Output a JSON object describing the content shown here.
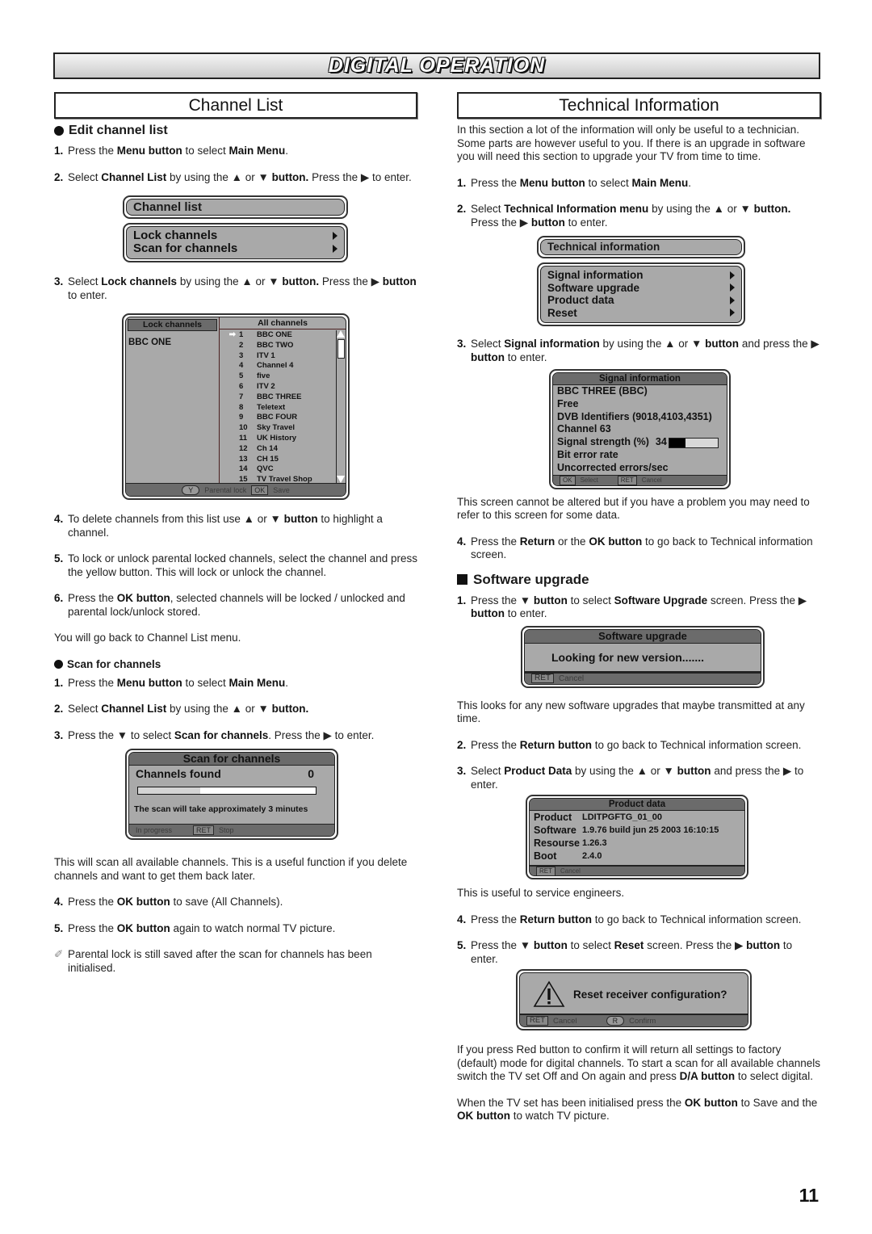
{
  "page": {
    "banner_title": "DIGITAL OPERATION",
    "page_number": "11"
  },
  "left": {
    "section_title": "Channel List",
    "edit": {
      "heading": "Edit channel list",
      "steps": [
        {
          "num": "1.",
          "parts": [
            [
              "Press the ",
              false
            ],
            [
              "Menu button",
              true
            ],
            [
              " to select ",
              false
            ],
            [
              "Main Menu",
              true
            ],
            [
              ".",
              false
            ]
          ]
        },
        {
          "num": "2.",
          "parts": [
            [
              "Select ",
              false
            ],
            [
              "Channel List",
              true
            ],
            [
              " by using the ▲ or ▼ ",
              false
            ],
            [
              "button.",
              true
            ],
            [
              "  Press the ▶ to enter.",
              false
            ]
          ]
        }
      ],
      "menu": {
        "title": "Channel list",
        "items": [
          {
            "label": "Lock channels",
            "icon": "arrow-right"
          },
          {
            "label": "Scan for channels",
            "icon": "arrow-right"
          }
        ]
      },
      "step3": {
        "num": "3.",
        "parts": [
          [
            "Select ",
            false
          ],
          [
            "Lock channels",
            true
          ],
          [
            " by using the ▲ or ▼ ",
            false
          ],
          [
            "button.",
            true
          ],
          [
            " Press the ▶ ",
            false
          ],
          [
            "button",
            true
          ],
          [
            " to enter.",
            false
          ]
        ]
      },
      "lock_screen": {
        "left_tab": "Lock channels",
        "current_channel": "BBC ONE",
        "right_tab": "All channels",
        "selected_index": 0,
        "channels": [
          {
            "num": "1",
            "name": "BBC ONE"
          },
          {
            "num": "2",
            "name": "BBC TWO"
          },
          {
            "num": "3",
            "name": "ITV 1"
          },
          {
            "num": "4",
            "name": "Channel 4"
          },
          {
            "num": "5",
            "name": "five"
          },
          {
            "num": "6",
            "name": "ITV 2"
          },
          {
            "num": "7",
            "name": "BBC THREE"
          },
          {
            "num": "8",
            "name": "Teletext"
          },
          {
            "num": "9",
            "name": "BBC FOUR"
          },
          {
            "num": "10",
            "name": "Sky Travel"
          },
          {
            "num": "11",
            "name": "UK History"
          },
          {
            "num": "12",
            "name": "Ch 14"
          },
          {
            "num": "13",
            "name": "CH 15"
          },
          {
            "num": "14",
            "name": "QVC"
          },
          {
            "num": "15",
            "name": "TV Travel Shop"
          }
        ],
        "footer": {
          "y_key": "Y",
          "y_label": "Parental lock",
          "ok_key": "OK",
          "ok_label": "Save"
        }
      },
      "steps_after": [
        {
          "num": "4.",
          "parts": [
            [
              "To delete channels from this list use ▲ or ▼ ",
              false
            ],
            [
              "button",
              true
            ],
            [
              " to highlight a channel.",
              false
            ]
          ]
        },
        {
          "num": "5.",
          "parts": [
            [
              "To lock or unlock parental locked channels, select the channel and press the yellow button. This will lock or unlock the channel.",
              false
            ]
          ]
        },
        {
          "num": "6.",
          "parts": [
            [
              "Press the ",
              false
            ],
            [
              "OK button",
              true
            ],
            [
              ", selected channels will be locked / unlocked and parental lock/unlock stored.",
              false
            ]
          ]
        }
      ],
      "back_text": "You will go back to Channel List menu."
    },
    "scan": {
      "heading": "Scan for channels",
      "steps": [
        {
          "num": "1.",
          "parts": [
            [
              "Press the ",
              false
            ],
            [
              "Menu button",
              true
            ],
            [
              " to select ",
              false
            ],
            [
              "Main Menu",
              true
            ],
            [
              ".",
              false
            ]
          ]
        },
        {
          "num": "2.",
          "parts": [
            [
              "Select ",
              false
            ],
            [
              "Channel List",
              true
            ],
            [
              " by using the ▲ or ▼ ",
              false
            ],
            [
              "button.",
              true
            ]
          ]
        },
        {
          "num": "3.",
          "parts": [
            [
              "Press the ▼ to select ",
              false
            ],
            [
              "Scan for channels",
              true
            ],
            [
              ". Press the ▶ to enter.",
              false
            ]
          ]
        }
      ],
      "screen": {
        "title": "Scan for channels",
        "found_label": "Channels found",
        "found_value": "0",
        "progress_fraction": 0.35,
        "message": "The scan will take approximately 3 minutes",
        "footer": {
          "status": "In progress",
          "ret_key": "RET",
          "ret_label": "Stop"
        }
      },
      "after_text": "This will scan all available channels. This is a useful function if you delete channels and want to get them back later.",
      "steps_after": [
        {
          "num": "4.",
          "parts": [
            [
              "Press the ",
              false
            ],
            [
              "OK button",
              true
            ],
            [
              " to save (All Channels).",
              false
            ]
          ]
        },
        {
          "num": "5.",
          "parts": [
            [
              "Press the ",
              false
            ],
            [
              "OK button",
              true
            ],
            [
              " again to watch normal TV picture.",
              false
            ]
          ]
        }
      ],
      "note": "Parental lock is still saved after the scan for channels has been initialised."
    }
  },
  "right": {
    "section_title": "Technical Information",
    "intro": "In this section a lot of the information will only be useful to a technician. Some parts are however useful to you. If there is an upgrade in software you will need this section to upgrade your TV from time to time.",
    "steps": [
      {
        "num": "1.",
        "parts": [
          [
            "Press the ",
            false
          ],
          [
            "Menu button",
            true
          ],
          [
            " to select ",
            false
          ],
          [
            "Main Menu",
            true
          ],
          [
            ".",
            false
          ]
        ]
      },
      {
        "num": "2.",
        "parts": [
          [
            "Select ",
            false
          ],
          [
            "Technical Information menu",
            true
          ],
          [
            " by using the ▲ or ▼ ",
            false
          ],
          [
            "button.",
            true
          ],
          [
            " Press the ▶ ",
            false
          ],
          [
            "button",
            true
          ],
          [
            " to enter.",
            false
          ]
        ]
      }
    ],
    "menu": {
      "title": "Technical information",
      "items": [
        {
          "label": "Signal information",
          "icon": "arrow-right"
        },
        {
          "label": "Software upgrade",
          "icon": "arrow-right"
        },
        {
          "label": "Product data",
          "icon": "arrow-right"
        },
        {
          "label": "Reset",
          "icon": "arrow-right"
        }
      ]
    },
    "step3": {
      "num": "3.",
      "parts": [
        [
          "Select ",
          false
        ],
        [
          "Signal information",
          true
        ],
        [
          " by using the ▲ or ▼ ",
          false
        ],
        [
          "button",
          true
        ],
        [
          " and press the ▶ ",
          false
        ],
        [
          "button",
          true
        ],
        [
          " to enter.",
          false
        ]
      ]
    },
    "signal": {
      "title": "Signal information",
      "lines": [
        "BBC THREE (BBC)",
        "Free",
        "DVB Identifiers (9018,4103,4351)",
        "Channel 63"
      ],
      "strength_label": "Signal strength (%)",
      "strength_value": "34",
      "strength_percent": 34,
      "lines_after": [
        "Bit error rate",
        "Uncorrected errors/sec"
      ],
      "footer": {
        "ok_key": "OK",
        "ok_label": "Select",
        "ret_key": "RET",
        "ret_label": "Cancel"
      }
    },
    "signal_note": "This screen cannot be altered but if you have a problem you may need to refer to this screen for some data.",
    "step4": {
      "num": "4.",
      "parts": [
        [
          "Press the ",
          false
        ],
        [
          "Return",
          true
        ],
        [
          " or the ",
          false
        ],
        [
          "OK button",
          true
        ],
        [
          " to go back to Technical information screen.",
          false
        ]
      ]
    },
    "software": {
      "heading": "Software upgrade",
      "step1": {
        "num": "1.",
        "parts": [
          [
            "Press the ▼ ",
            false
          ],
          [
            "button",
            true
          ],
          [
            " to select ",
            false
          ],
          [
            "Software Upgrade",
            true
          ],
          [
            " screen. Press the ▶ ",
            false
          ],
          [
            "button",
            true
          ],
          [
            " to enter.",
            false
          ]
        ]
      },
      "screen": {
        "title": "Software upgrade",
        "message": "Looking for new version.......",
        "footer": {
          "ret_key": "RET",
          "ret_label": "Cancel"
        }
      },
      "after_text": "This looks for any new software upgrades that maybe transmitted at any time.",
      "step2": {
        "num": "2.",
        "parts": [
          [
            "Press the ",
            false
          ],
          [
            "Return button",
            true
          ],
          [
            " to go back to Technical information screen.",
            false
          ]
        ]
      },
      "step3": {
        "num": "3.",
        "parts": [
          [
            "Select ",
            false
          ],
          [
            "Product Data",
            true
          ],
          [
            " by using the ▲ or ▼ ",
            false
          ],
          [
            "button",
            true
          ],
          [
            " and press the ▶ to enter.",
            false
          ]
        ]
      }
    },
    "product": {
      "title": "Product data",
      "rows": [
        {
          "key": "Product",
          "value": "LDITPGFTG_01_00"
        },
        {
          "key": "Software",
          "value": "1.9.76 build jun 25 2003 16:10:15"
        },
        {
          "key": "Resourse",
          "value": "1.26.3"
        },
        {
          "key": "Boot",
          "value": "2.4.0"
        }
      ],
      "footer": {
        "ret_key": "RET",
        "ret_label": "Cancel"
      }
    },
    "product_note": "This is useful to service engineers.",
    "step4b": {
      "num": "4.",
      "parts": [
        [
          "Press the ",
          false
        ],
        [
          "Return button",
          true
        ],
        [
          " to go back to Technical information screen.",
          false
        ]
      ]
    },
    "step5": {
      "num": "5.",
      "parts": [
        [
          "Press the ▼ ",
          false
        ],
        [
          "button",
          true
        ],
        [
          " to select ",
          false
        ],
        [
          "Reset",
          true
        ],
        [
          " screen. Press the ▶ ",
          false
        ],
        [
          "button",
          true
        ],
        [
          " to enter.",
          false
        ]
      ]
    },
    "reset": {
      "icon": "warning-icon",
      "message": "Reset receiver configuration?",
      "footer": {
        "ret_key": "RET",
        "ret_label": "Cancel",
        "r_key": "R",
        "r_label": "Confirm"
      }
    },
    "reset_text": [
      [
        "If you press Red button to confirm it will return all settings to factory (default) mode for digital channels. To start a scan for all available channels switch the TV set Off and On again and press ",
        false
      ],
      [
        "D/A button",
        true
      ],
      [
        " to select digital.",
        false
      ]
    ],
    "final_text": [
      [
        "When the TV set has been initialised press the ",
        false
      ],
      [
        "OK button",
        true
      ],
      [
        " to Save and the ",
        false
      ],
      [
        "OK button",
        true
      ],
      [
        " to watch TV picture.",
        false
      ]
    ]
  }
}
